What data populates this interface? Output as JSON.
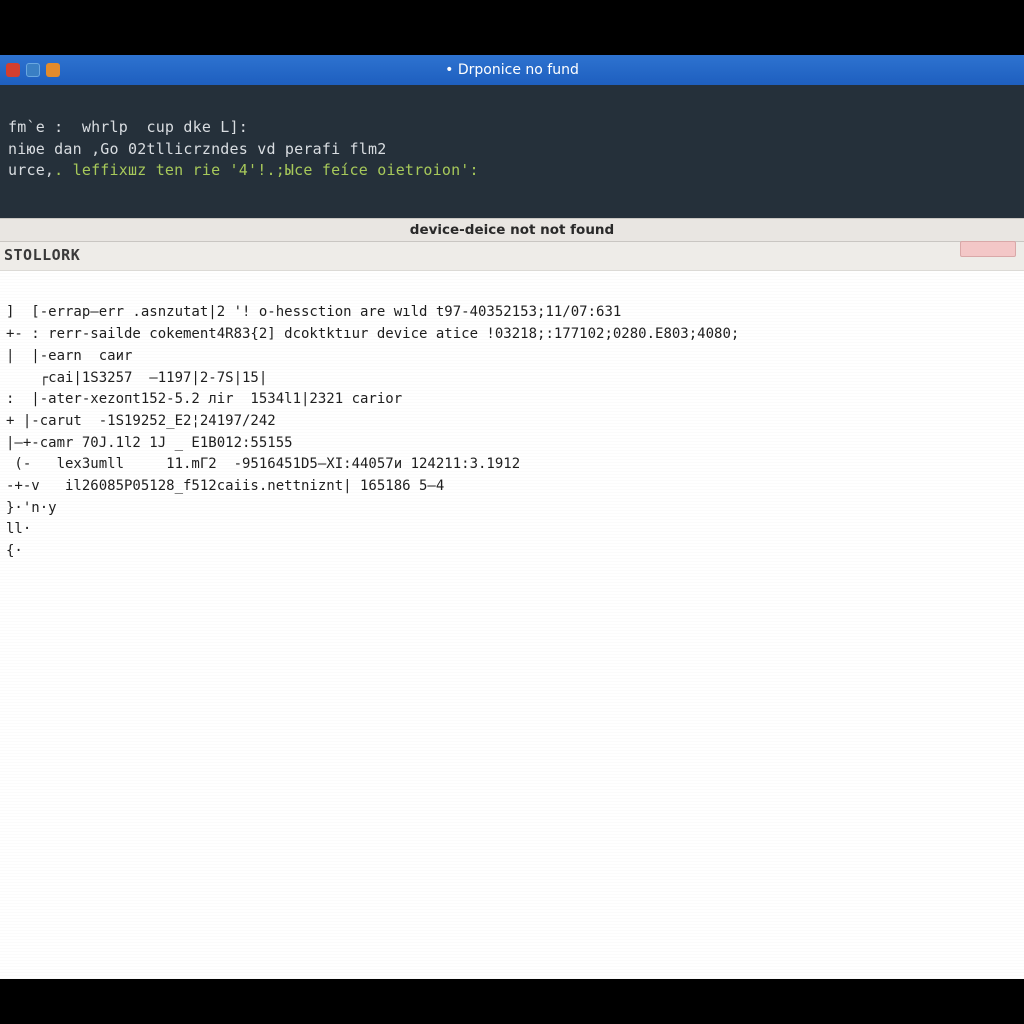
{
  "window": {
    "title": "• Drponice no fund"
  },
  "terminal": {
    "line1": "fm`e :  whrlp  cup dke L]:",
    "line2": "niюe dan ,Gо 02tllicrzndes vd рerаfi flm2",
    "line3_lead": "urce,",
    "line3_rest": ". lеffixшz ten riе '4'!.;Ыce feíce оietrоion':"
  },
  "pane": {
    "header": "device-deice not not found",
    "subheader": "STOLLORK"
  },
  "output": {
    "lines": [
      "]  [-errap—err .asnzutat|2 '! o-hessction are wıld t97-40352153;11/07:631",
      "+- : rerr-sailde cokement4R83{2] dcoktktıur device atice !03218;:177102;0280.E803;4080;",
      "|  |-earn  caиr",
      "    ┌cai|1S3257  —1197|2-7S|15|",
      ":  |-ater-xezопt152-5.2 лir  1534l1|2321 carior",
      "+ |-carut  -1S19252_E2¦24197/242",
      "|—+-camr 70J.1l2 1J _ E1B012:55155",
      " (-   lexЗumll     11.mГ2  -9516451D5—XI:44057и 124211:3.1912",
      "-+-v   il26085P05128_f512caiis.nettniznt| 165186 5—4",
      "}·'n·y",
      "ll·",
      "{·"
    ]
  },
  "icons": {
    "close": "window-close-icon",
    "minimize": "window-minimize-icon",
    "maximize": "window-maximize-icon"
  },
  "colors": {
    "titlebar": "#2168c8",
    "terminal_bg": "#25303a",
    "terminal_green": "#a7c95a",
    "pane_header_bg": "#e9e6e2",
    "pill_bg": "#f3c7c7"
  }
}
